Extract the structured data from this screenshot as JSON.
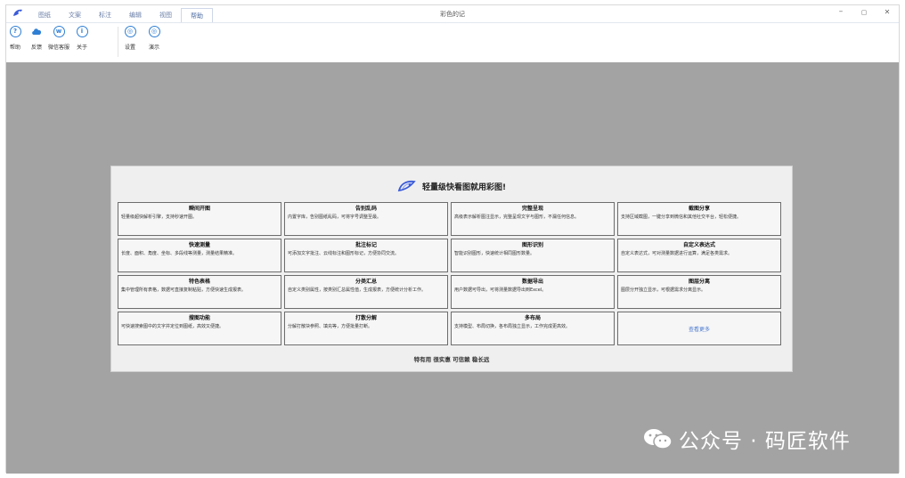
{
  "window": {
    "title": "彩色的记",
    "tabs": [
      {
        "label": "图纸"
      },
      {
        "label": "文案"
      },
      {
        "label": "标注"
      },
      {
        "label": "编辑"
      },
      {
        "label": "视图"
      },
      {
        "label": "帮助"
      }
    ],
    "controls": {
      "minimize": "–",
      "maximize": "▢",
      "close": "✕"
    }
  },
  "ribbon": {
    "buttons": [
      {
        "label": "帮助",
        "icon": "help-icon",
        "glyph": "?"
      },
      {
        "label": "反馈",
        "icon": "cloud-icon",
        "glyph": ""
      },
      {
        "label": "微信客服",
        "icon": "wechat-icon",
        "glyph": "w"
      },
      {
        "label": "关于",
        "icon": "info-icon",
        "glyph": "i"
      },
      {
        "label": "设置",
        "icon": "settings-icon",
        "glyph": "◎"
      },
      {
        "label": "演示",
        "icon": "play-icon",
        "glyph": "◎"
      }
    ]
  },
  "panel": {
    "title": "轻量级快看图就用彩图!",
    "features": [
      {
        "title": "瞬间开图",
        "desc": "轻量级超快解析引擎，支持秒速开图。"
      },
      {
        "title": "告别乱码",
        "desc": "内置字库，告别图纸乱码，可将字号调整至最。"
      },
      {
        "title": "完整呈现",
        "desc": "高级表示解析图注显示，完整呈现文字与图形，不漏任何信息。"
      },
      {
        "title": "截图分享",
        "desc": "支持区域截图，一键分享到微信和其他社交平台，轻松便捷。"
      },
      {
        "title": "快速测量",
        "desc": "长度、面积、角度、坐标、多段线等测量，测量结果精准。"
      },
      {
        "title": "批注标记",
        "desc": "可添加文字批注、云线标注和图形标记，方便协同交流。"
      },
      {
        "title": "图形识别",
        "desc": "智能识别图形，快速统计相同图形数量。"
      },
      {
        "title": "自定义表达式",
        "desc": "自定义表达式，可对测量数据进行运算，满足各类需求。"
      },
      {
        "title": "特色表格",
        "desc": "集中管理所有表格，数据可直接复制粘贴，方便快速生成报表。"
      },
      {
        "title": "分类汇总",
        "desc": "自定义类别属性，按类别汇总属性值，生成报表，方便统计分析工作。"
      },
      {
        "title": "数据导出",
        "desc": "用户数据可导出，可将测量数据导出到Excel。"
      },
      {
        "title": "图层分离",
        "desc": "图层分开独立显示，可根据需求分离显示。"
      },
      {
        "title": "搜图功能",
        "desc": "可快速搜索图中的文字并定位到图纸，高效又便捷。"
      },
      {
        "title": "打散分解",
        "desc": "分解打散块参照、填充等，方便批量打断。"
      },
      {
        "title": "多布局",
        "desc": "支持模型、布局切换，各布局独立显示，工作完成更高效。"
      }
    ],
    "more_label": "查看更多",
    "footer": "特有用 很实惠 可信赖 稳长远"
  },
  "watermark": {
    "text": "公众号 · 码匠软件"
  },
  "colors": {
    "accent": "#2f7fd4",
    "workspace": "#a3a3a3",
    "panel": "#efefef"
  }
}
